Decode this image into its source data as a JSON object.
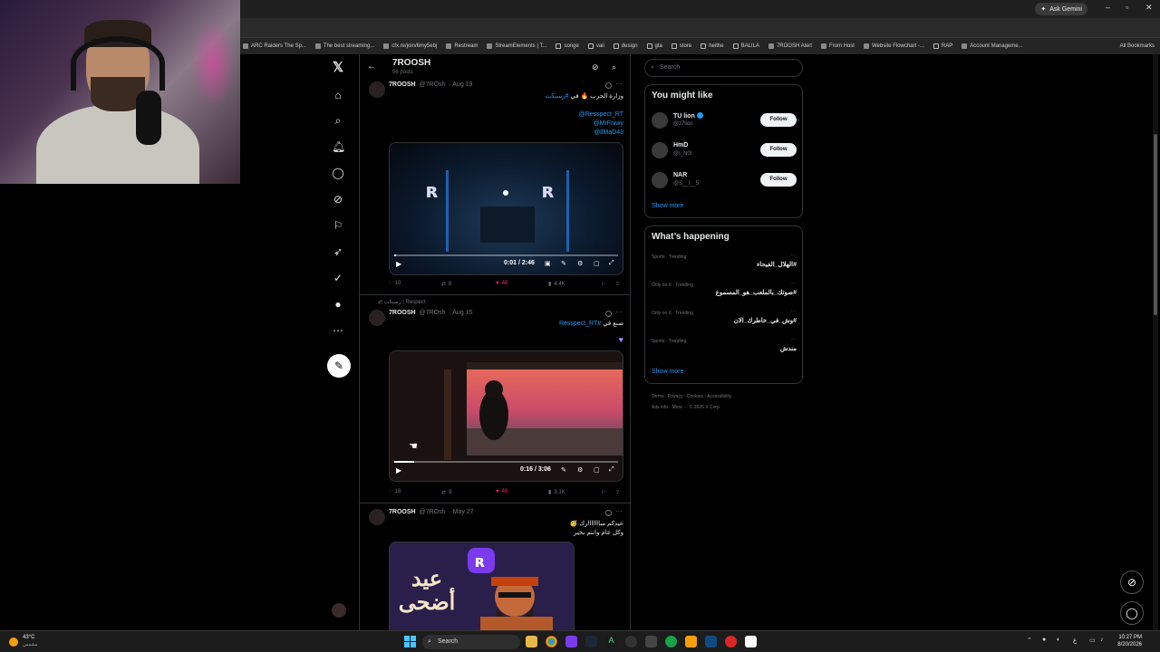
{
  "browser": {
    "gemini_label": "Ask Gemini",
    "bookmarks": [
      {
        "label": "ARC Raiders The Sp...",
        "type": "site"
      },
      {
        "label": "The best streaming...",
        "type": "site"
      },
      {
        "label": "cfx.re/join/6my5ebj",
        "type": "site"
      },
      {
        "label": "Restream",
        "type": "site"
      },
      {
        "label": "StreamElements | T...",
        "type": "site"
      },
      {
        "label": "songe",
        "type": "folder"
      },
      {
        "label": "vaii",
        "type": "folder"
      },
      {
        "label": "design",
        "type": "folder"
      },
      {
        "label": "gta",
        "type": "folder"
      },
      {
        "label": "store",
        "type": "folder"
      },
      {
        "label": "heithe",
        "type": "folder"
      },
      {
        "label": "BALILA",
        "type": "folder"
      },
      {
        "label": "7ROOSH Alert",
        "type": "site"
      },
      {
        "label": "From Host",
        "type": "site"
      },
      {
        "label": "Website Flowchart -...",
        "type": "site"
      },
      {
        "label": "RAP",
        "type": "folder"
      },
      {
        "label": "Account Manageme...",
        "type": "site"
      }
    ],
    "all_bookmarks": "All Bookmarks"
  },
  "profile": {
    "name": "7ROOSH",
    "posts_count": "56 posts"
  },
  "tweets": [
    {
      "name": "7ROOSH",
      "handle": "@7ROsh",
      "date": "· Aug 19",
      "text": "وزارة الحرب 🔥 في",
      "hashtag": "#رسبكت",
      "mentions": [
        "@Resspect_RT",
        "@MrFniwy",
        "@llMaD43"
      ],
      "video_time": "0:01 / 2:46",
      "progress": 0.01,
      "replies": "10",
      "reposts": "8",
      "likes": "48",
      "views": "4.4K"
    },
    {
      "repost_label": "رسبكت | Respect",
      "name": "7ROOSH",
      "handle": "@7ROsh",
      "date": "· Aug 15",
      "text": "صنع في",
      "hashtag": "#Resspect_RT",
      "video_time": "0:16 / 3:06",
      "progress": 0.09,
      "replies": "18",
      "reposts": "9",
      "likes": "48",
      "views": "3.1K"
    },
    {
      "name": "7ROOSH",
      "handle": "@7ROsh",
      "date": "· May 27",
      "text_line1": "عيدكم مبااااااارك 🥳",
      "text_line2": "وكل عام وانتم بخير",
      "image_text": "عيد أضحى"
    }
  ],
  "sidebar_right": {
    "search_placeholder": "Search",
    "might_like_title": "You might like",
    "suggestions": [
      {
        "name": "TU lion",
        "handle": "@z7lion",
        "verified": true,
        "button": "Follow"
      },
      {
        "name": "HmD",
        "handle": "@I_N0t",
        "verified": false,
        "button": "Follow"
      },
      {
        "name": "NAR",
        "handle": "@S__l__5",
        "verified": false,
        "button": "Follow"
      }
    ],
    "show_more": "Show more",
    "happening_title": "What’s happening",
    "trends": [
      {
        "category": "Sports · Trending",
        "title": "#الهلال_الفيحاء"
      },
      {
        "category": "Only on X · Trending",
        "title": "#صوتك_بالملعب_هو_المسموع"
      },
      {
        "category": "Only on X · Trending",
        "title": "#وش_في_خاطرك_الان"
      },
      {
        "category": "Sports · Trending",
        "title": "مندش"
      }
    ],
    "show_more_2": "Show more",
    "footer_line1": "Terms · Privacy · Cookies · Accessibility ·",
    "footer_line2": "Ads info · More ··· © 2026 X Corp."
  },
  "taskbar": {
    "weather_temp": "43°C",
    "weather_cond": "مشمس",
    "search_label": "Search",
    "time": "10:27 PM",
    "date": "8/20/2026",
    "lang": "ع"
  },
  "colors": {
    "accent": "#1d9bf0",
    "like": "#f91880",
    "background": "#000000"
  }
}
